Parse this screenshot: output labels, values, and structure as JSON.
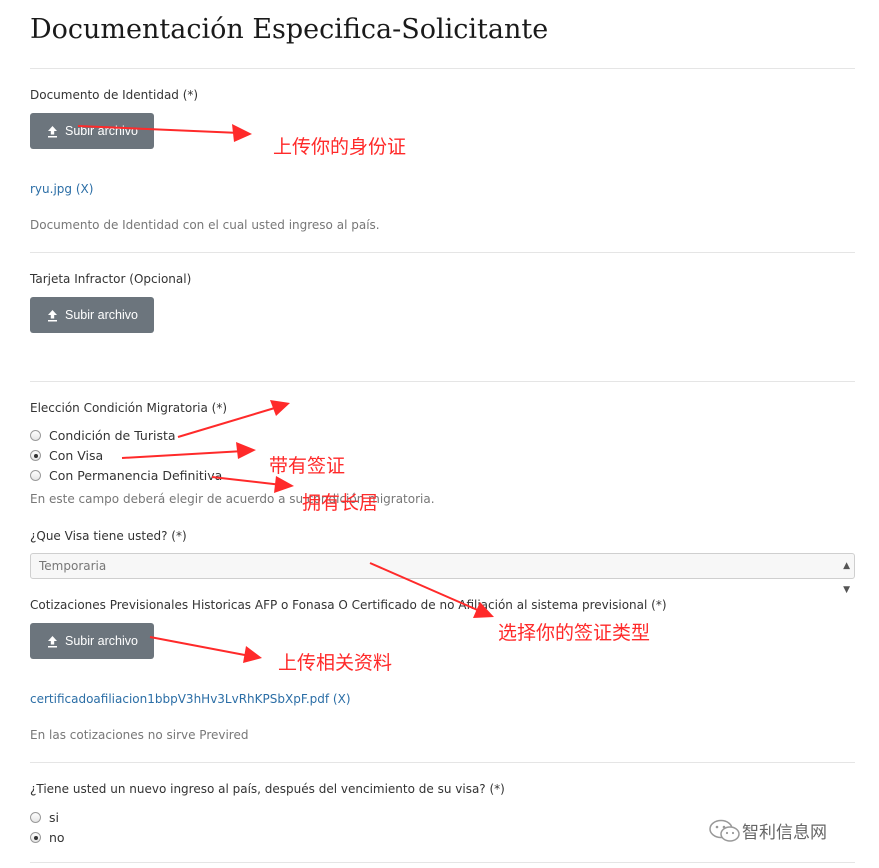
{
  "page": {
    "title": "Documentación Especifica-Solicitante"
  },
  "identity": {
    "label": "Documento de Identidad (*)",
    "upload_label": "Subir archivo",
    "file_name": "ryu.jpg",
    "file_remove": "(X)",
    "help": "Documento de Identidad con el cual usted ingreso al país."
  },
  "infractor": {
    "label": "Tarjeta Infractor (Opcional)",
    "upload_label": "Subir archivo"
  },
  "migratoria": {
    "label": "Elección Condición Migratoria (*)",
    "options": [
      {
        "label": "Condición de Turista",
        "checked": false
      },
      {
        "label": "Con Visa",
        "checked": true
      },
      {
        "label": "Con Permanencia Definitiva",
        "checked": false
      }
    ],
    "help": "En este campo deberá elegir de acuerdo a su condición migratoria."
  },
  "visa": {
    "label": "¿Que Visa tiene usted? (*)",
    "selected": "Temporaria"
  },
  "cotizaciones": {
    "label": "Cotizaciones Previsionales Historicas AFP o Fonasa O Certificado de no Afiliación al sistema previsional (*)",
    "upload_label": "Subir archivo",
    "file_name": "certificadoafiliacion1bbpV3hHv3LvRhKPSbXpF.pdf",
    "file_remove": "(X)",
    "help": "En las cotizaciones no sirve Previred"
  },
  "nuevo_ingreso": {
    "label": "¿Tiene usted un nuevo ingreso al país, después del vencimiento de su visa? (*)",
    "options": [
      {
        "label": "si",
        "checked": false
      },
      {
        "label": "no",
        "checked": true
      }
    ]
  },
  "annotations": {
    "upload_id": "上传你的身份证",
    "with_visa": "带有签证",
    "permanent": "拥有长居",
    "choose_visa": "选择你的签证类型",
    "upload_docs": "上传相关资料"
  },
  "watermark": {
    "text": "智利信息网"
  },
  "colors": {
    "annotation": "#ff2a2a",
    "button": "#6c757d",
    "link": "#2b6ea6"
  }
}
